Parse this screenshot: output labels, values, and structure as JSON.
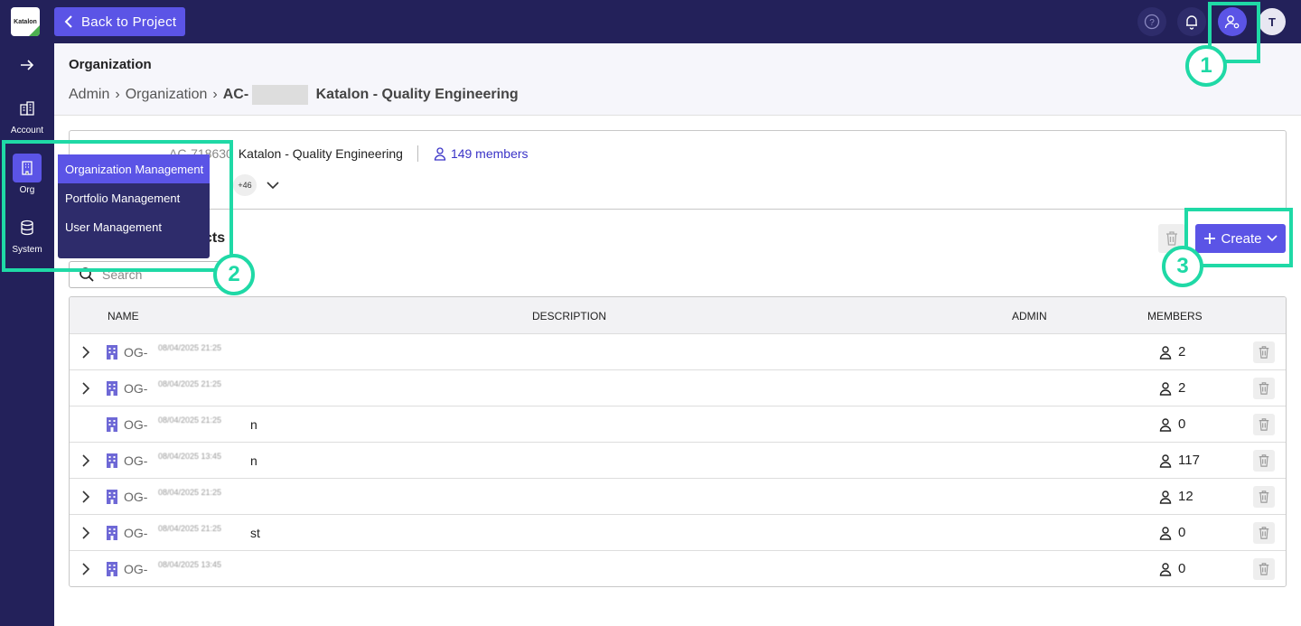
{
  "topbar": {
    "logo_text": "Katalon",
    "back_label": "Back to Project",
    "avatar_initial": "T"
  },
  "sidebar": {
    "items": [
      {
        "label": "Account"
      },
      {
        "label": "Org"
      },
      {
        "label": "System"
      }
    ]
  },
  "header": {
    "title": "Organization",
    "breadcrumb": [
      "Admin",
      "Organization"
    ],
    "current_prefix": "AC-",
    "current_name": "Katalon - Quality Engineering"
  },
  "account_card": {
    "code": "AC-718630",
    "name": "Katalon - Quality Engineering",
    "members_label": "149 members",
    "more_count": "+46"
  },
  "org_menu": [
    "Organization Management",
    "Portfolio Management",
    "User Management"
  ],
  "section": {
    "title_visible": "cts",
    "search_placeholder": "Search",
    "create_label": "Create"
  },
  "table": {
    "headers": [
      "NAME",
      "DESCRIPTION",
      "ADMIN",
      "MEMBERS"
    ],
    "rows": [
      {
        "code": "OG-",
        "stamp": "08/04/2025 21:25",
        "tail": "",
        "members": "2",
        "expandable": true
      },
      {
        "code": "OG-",
        "stamp": "08/04/2025 21:25",
        "tail": "",
        "members": "2",
        "expandable": true
      },
      {
        "code": "OG-",
        "stamp": "08/04/2025 21:25",
        "tail": "n",
        "members": "0",
        "expandable": false
      },
      {
        "code": "OG-",
        "stamp": "08/04/2025 13:45",
        "tail": "n",
        "members": "117",
        "expandable": true
      },
      {
        "code": "OG-",
        "stamp": "08/04/2025 21:25",
        "tail": "",
        "members": "12",
        "expandable": true
      },
      {
        "code": "OG-",
        "stamp": "08/04/2025 21:25",
        "tail": "st",
        "members": "0",
        "expandable": true
      },
      {
        "code": "OG-",
        "stamp": "08/04/2025 13:45",
        "tail": "",
        "members": "0",
        "expandable": true
      }
    ]
  },
  "callouts": [
    "1",
    "2",
    "3"
  ],
  "colors": {
    "nav": "#23215a",
    "accent": "#5b54e6",
    "highlight": "#1fd9a6",
    "link": "#3a33c7"
  }
}
